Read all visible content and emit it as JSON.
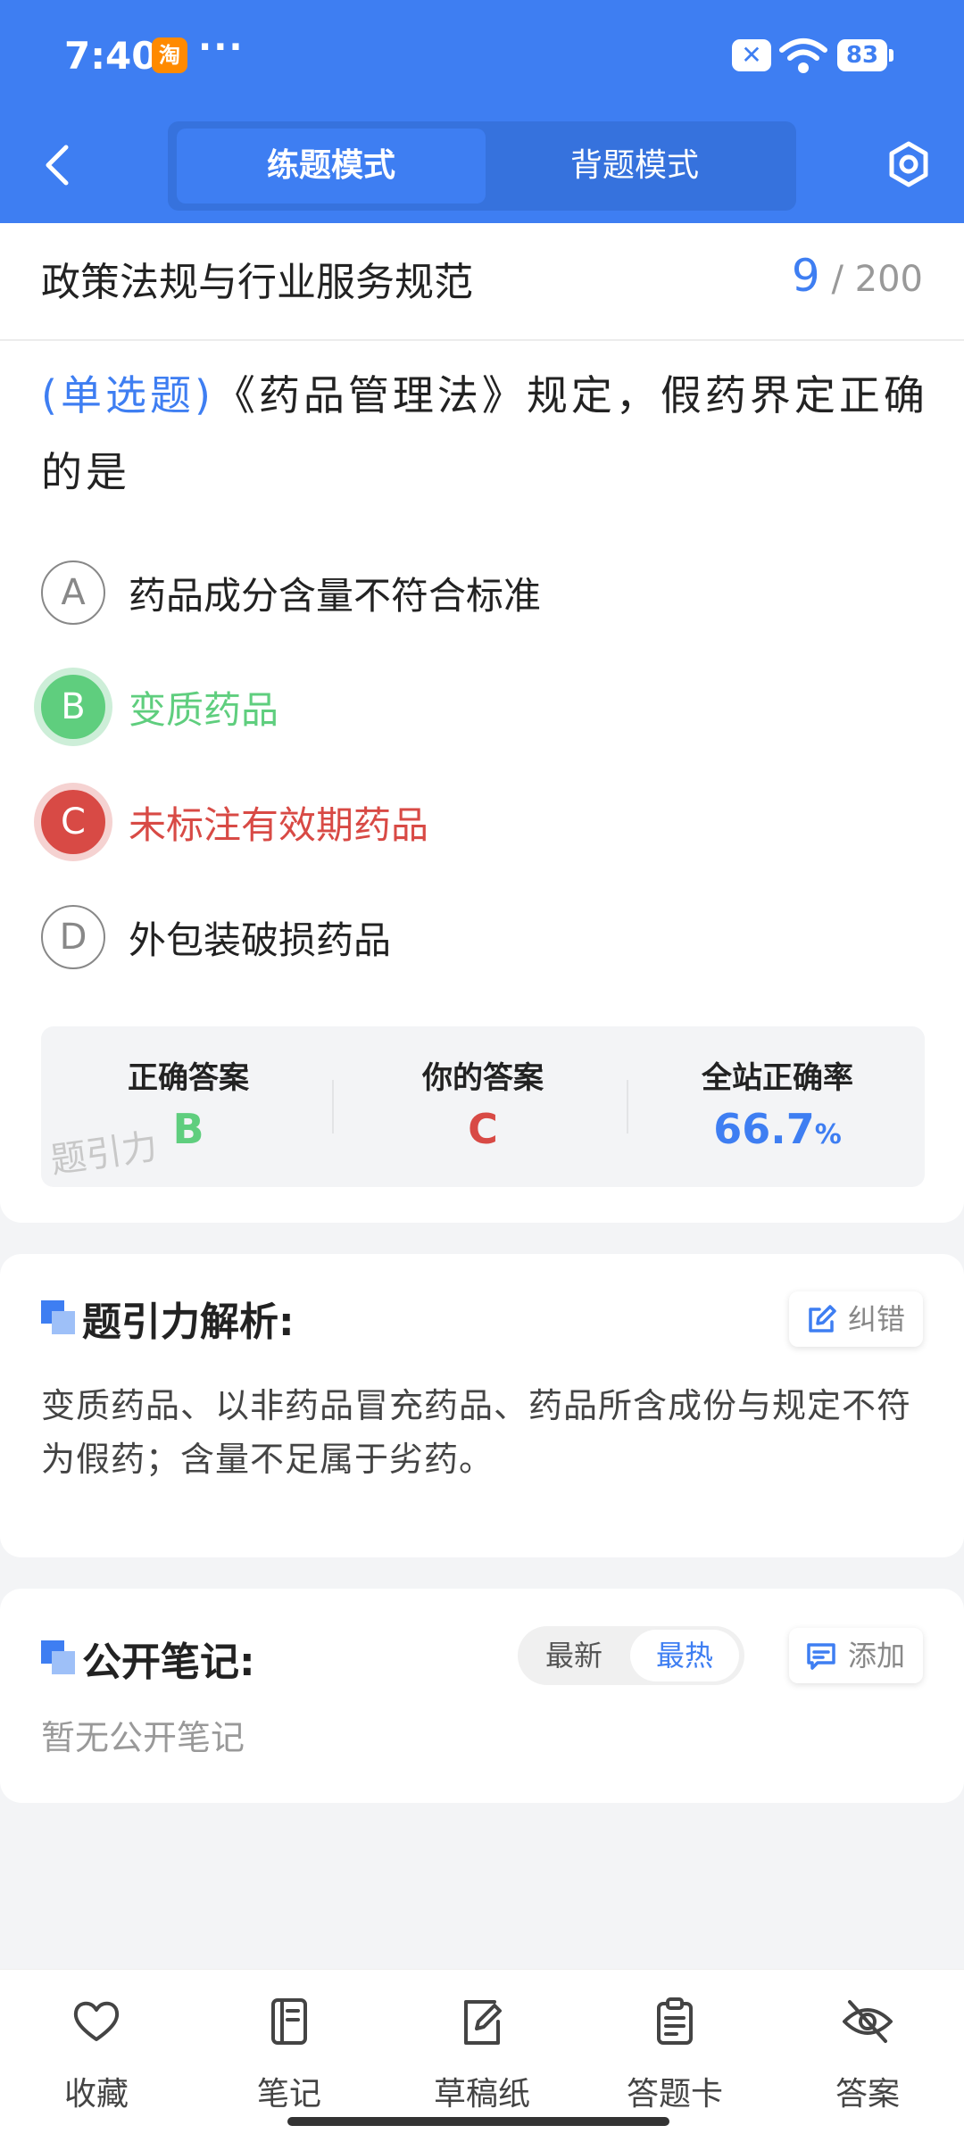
{
  "status_bar": {
    "time": "7:40",
    "app_badge": "淘",
    "dots": "···",
    "battery": "83"
  },
  "header": {
    "tabs": [
      "练题模式",
      "背题模式"
    ]
  },
  "question": {
    "subject": "政策法规与行业服务规范",
    "current": "9",
    "total": "/ 200",
    "type": "(单选题)",
    "text": "《药品管理法》规定，假药界定正确的是",
    "options": [
      {
        "letter": "A",
        "text": "药品成分含量不符合标准",
        "state": "normal"
      },
      {
        "letter": "B",
        "text": "变质药品",
        "state": "correct"
      },
      {
        "letter": "C",
        "text": "未标注有效期药品",
        "state": "wrong"
      },
      {
        "letter": "D",
        "text": "外包装破损药品",
        "state": "normal"
      }
    ]
  },
  "stats": {
    "correct_label": "正确答案",
    "correct_value": "B",
    "yours_label": "你的答案",
    "yours_value": "C",
    "rate_label": "全站正确率",
    "rate_value": "66.7",
    "rate_unit": "%",
    "watermark": "题引力"
  },
  "analysis": {
    "title": "题引力解析:",
    "report_label": "纠错",
    "text": "变质药品、以非药品冒充药品、药品所含成份与规定不符为假药；含量不足属于劣药。"
  },
  "notes": {
    "title": "公开笔记:",
    "sort_newest": "最新",
    "sort_hottest": "最热",
    "add_label": "添加",
    "empty": "暂无公开笔记"
  },
  "bottom_bar": [
    "收藏",
    "笔记",
    "草稿纸",
    "答题卡",
    "答案"
  ],
  "colors": {
    "brand": "#3e7ef2",
    "correct": "#5fce7e",
    "wrong": "#d84a45"
  }
}
